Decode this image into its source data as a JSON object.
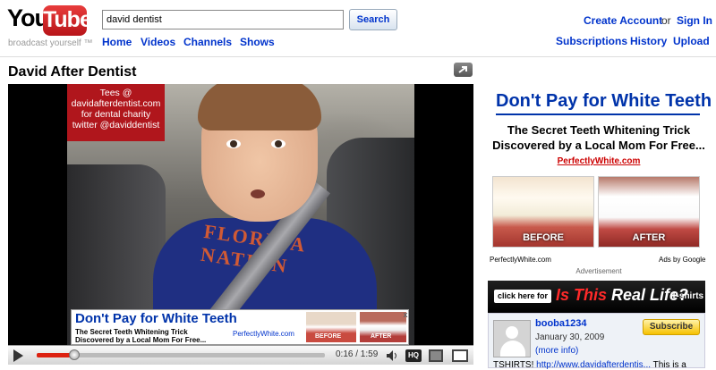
{
  "header": {
    "logo_you": "You",
    "logo_tube": "Tube",
    "slogan": "broadcast yourself ™",
    "search": {
      "value": "david dentist",
      "button_label": "Search"
    },
    "nav": [
      "Home",
      "Videos",
      "Channels",
      "Shows"
    ],
    "user_links": {
      "create_account": "Create Account",
      "or": "or",
      "sign_in": "Sign In"
    },
    "user_nav": [
      "Subscriptions",
      "History",
      "Upload"
    ]
  },
  "video": {
    "title": "David After Dentist",
    "overlay_lines": [
      "Tees @",
      "davidafterdentist.com",
      "for dental charity",
      "twitter @daviddentist"
    ],
    "shirt_text": "FLORIDA NATION",
    "player": {
      "time": "0:16 / 1:59",
      "progress": 0.13,
      "hq_label": "HQ"
    },
    "in_video_ad": {
      "headline": "Don't Pay for White Teeth",
      "sub_line1": "The Secret Teeth Whitening Trick",
      "sub_line2": "Discovered by a Local Mom For Free...",
      "url": "PerfectlyWhite.com",
      "before": "BEFORE",
      "after": "AFTER",
      "close": "x"
    }
  },
  "sidebar_ad": {
    "title": "Don't Pay for White Teeth",
    "subtitle_line1": "The Secret Teeth Whitening Trick",
    "subtitle_line2": "Discovered by a Local Mom For Free...",
    "url": "PerfectlyWhite.com",
    "before_label": "BEFORE",
    "after_label": "AFTER",
    "small_url": "PerfectlyWhite.com",
    "ads_by": "Ads by Google",
    "advertisement_label": "Advertisement"
  },
  "banner": {
    "button": "click here for",
    "text_red": "Is This",
    "text_white": " Real Life?",
    "suffix": "T-shirts"
  },
  "channel": {
    "name": "booba1234",
    "date": "January 30, 2009",
    "more_info": "(more info)",
    "subscribe": "Subscribe",
    "desc_prefix": "TSHIRTS! ",
    "desc_link": "http://www.davidafterdentis...",
    "desc_suffix": " This is a"
  },
  "colors": {
    "brand_red": "#cc181e",
    "link_blue": "#0033cc",
    "ad_blue": "#0033aa"
  }
}
